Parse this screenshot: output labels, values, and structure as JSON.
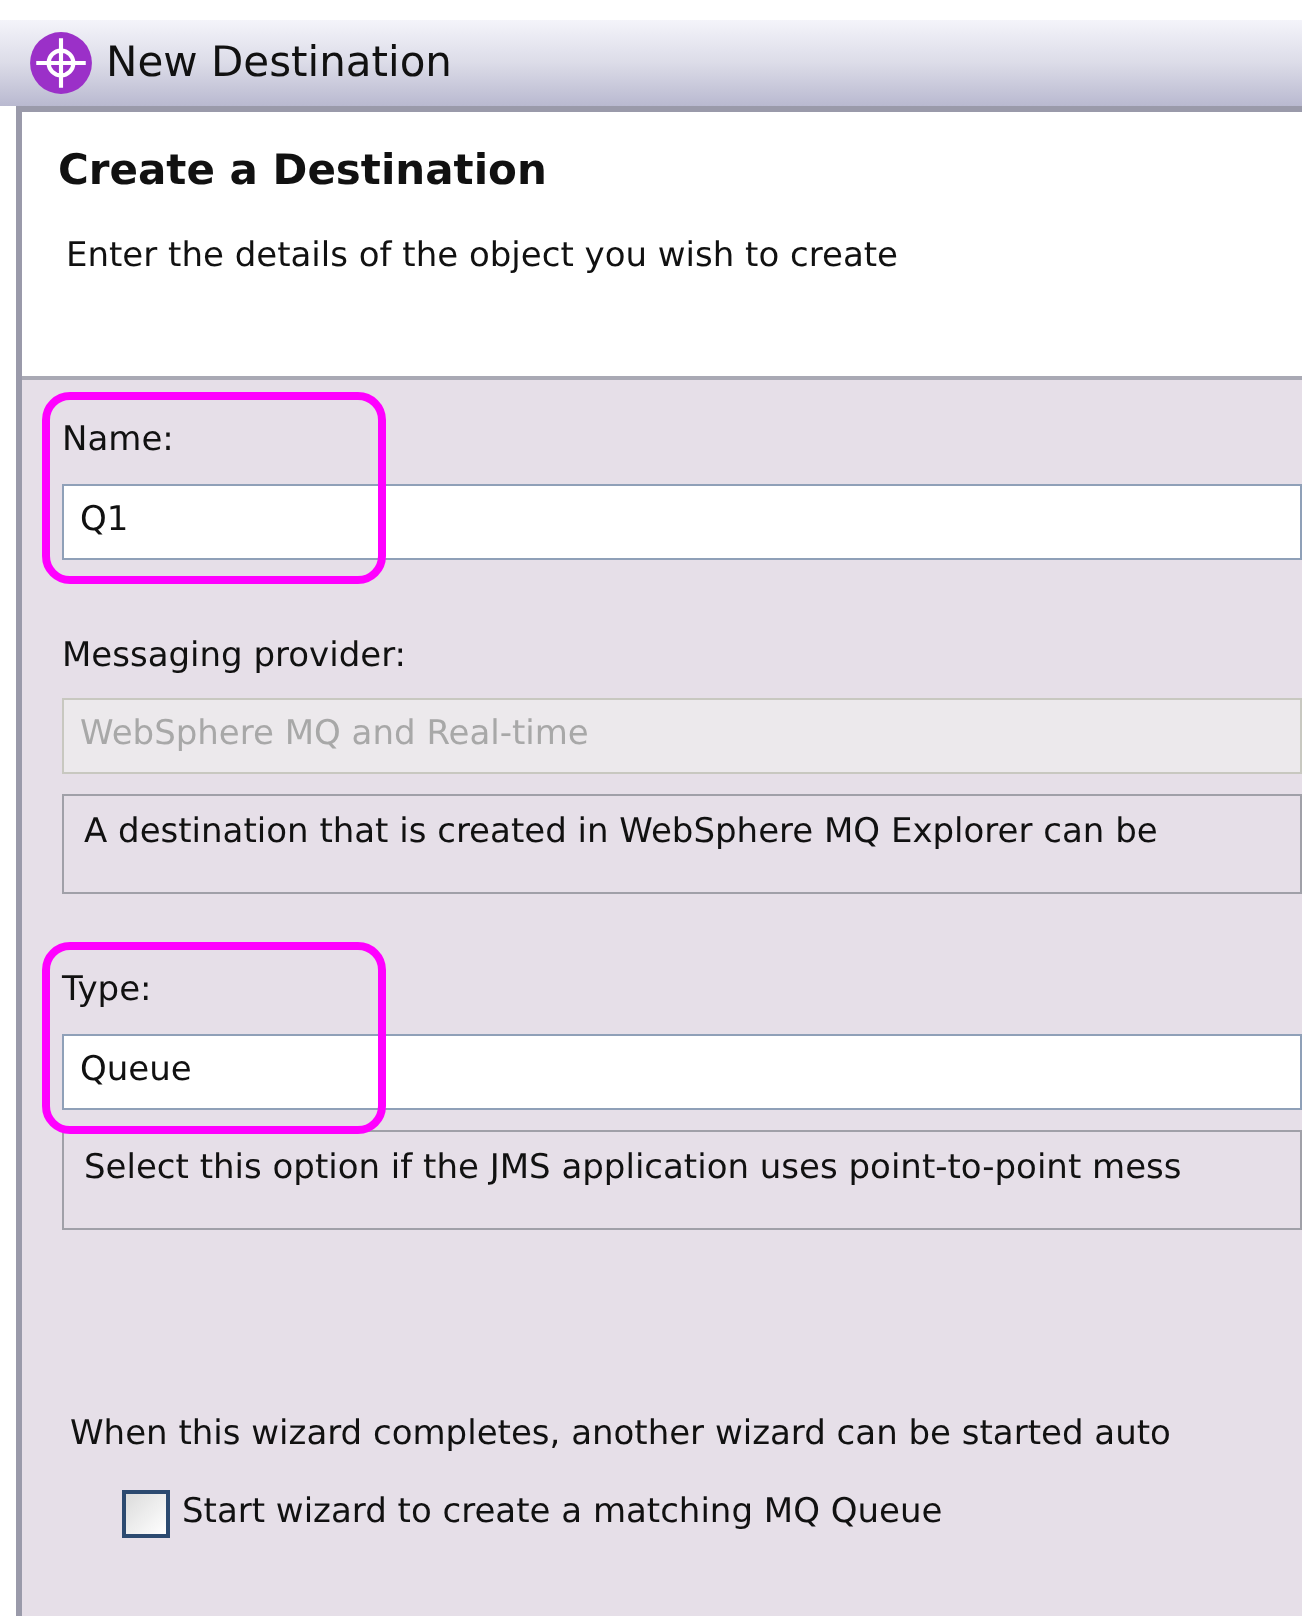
{
  "window": {
    "title": "New Destination"
  },
  "header": {
    "title": "Create a Destination",
    "description": "Enter the details of the object you wish to create"
  },
  "fields": [
    {
      "kind": "text",
      "label": "Name:",
      "value": "Q1",
      "disabled": false,
      "highlighted": true
    },
    {
      "kind": "text",
      "label": "Messaging provider:",
      "value": "WebSphere MQ and Real-time",
      "disabled": true,
      "highlighted": false,
      "note": "A destination that is created in WebSphere MQ Explorer can be"
    },
    {
      "kind": "text",
      "label": "Type:",
      "value": "Queue",
      "disabled": false,
      "highlighted": true,
      "note": "Select this option if the JMS application uses point-to-point mess"
    }
  ],
  "wizard_note": "When this wizard completes, another wizard can be started auto",
  "checkbox": {
    "label": "Start wizard to create a matching MQ Queue",
    "checked": false
  }
}
